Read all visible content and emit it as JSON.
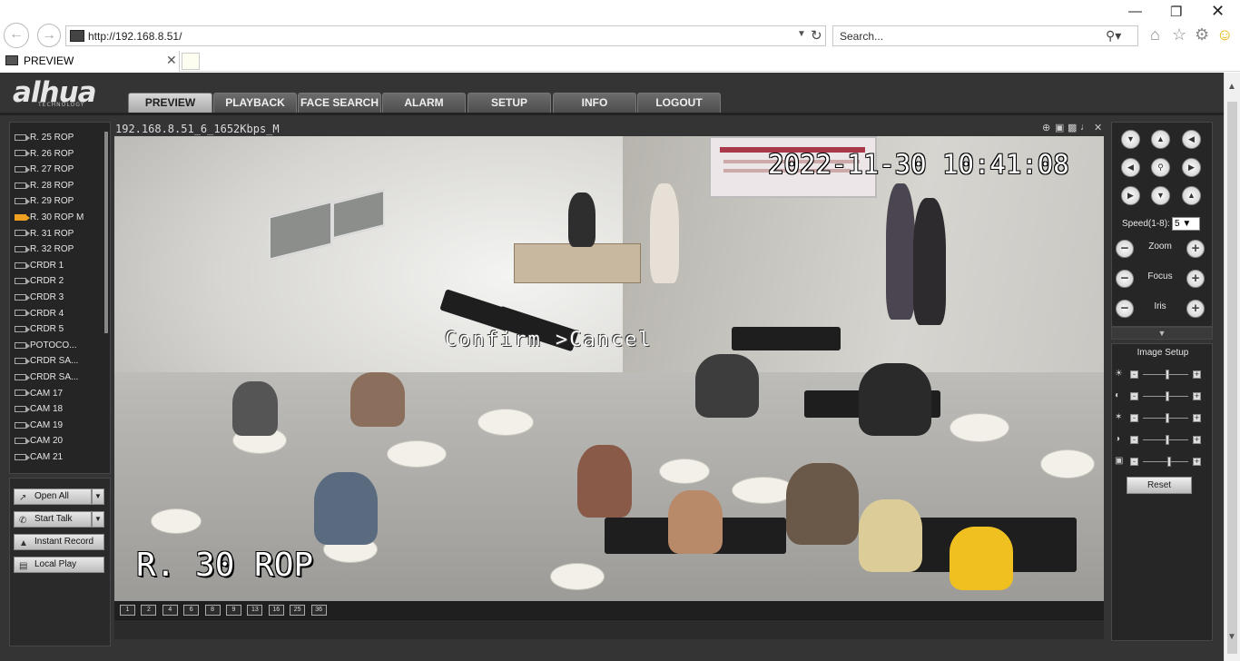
{
  "browser": {
    "url": "http://192.168.8.51/",
    "search_placeholder": "Search...",
    "tab_title": "PREVIEW"
  },
  "menu": [
    "PREVIEW",
    "PLAYBACK",
    "FACE SEARCH",
    "ALARM",
    "SETUP",
    "INFO",
    "LOGOUT"
  ],
  "active_menu": "PREVIEW",
  "cameras": [
    "R. 25 ROP",
    "R. 26 ROP",
    "R. 27 ROP",
    "R. 28 ROP",
    "R. 29 ROP",
    "R. 30 ROP   M",
    "R. 31 ROP",
    "R. 32 ROP",
    "CRDR 1",
    "CRDR 2",
    "CRDR 3",
    "CRDR 4",
    "CRDR 5",
    "POTOCO...",
    "CRDR SA...",
    "CRDR SA...",
    "CAM 17",
    "CAM 18",
    "CAM 19",
    "CAM 20",
    "CAM 21"
  ],
  "selected_camera": "R. 30 ROP   M",
  "buttons": {
    "open_all": "Open All",
    "start_talk": "Start Talk",
    "instant_record": "Instant Record",
    "local_play": "Local Play"
  },
  "video": {
    "stream_title": "192.168.8.51_6_1652Kbps_M",
    "timestamp": "2022-11-30 10:41:08",
    "osd_menu": "Confirm  >Cancel",
    "camera_name": "R. 30 ROP"
  },
  "ptz": {
    "speed_label": "Speed(1-8):",
    "speed_value": "5",
    "zoom": "Zoom",
    "focus": "Focus",
    "iris": "Iris"
  },
  "image_setup": {
    "title": "Image Setup",
    "reset": "Reset",
    "sliders": [
      "brightness-icon",
      "contrast-icon",
      "saturation-icon",
      "gain-icon",
      "sharpness-icon"
    ]
  },
  "layout_buttons": [
    "1",
    "2",
    "4",
    "6",
    "8",
    "9",
    "13",
    "16",
    "25",
    "36"
  ],
  "colors": {
    "page_bg": "#343434",
    "selected_camera_icon": "#f0a020"
  }
}
